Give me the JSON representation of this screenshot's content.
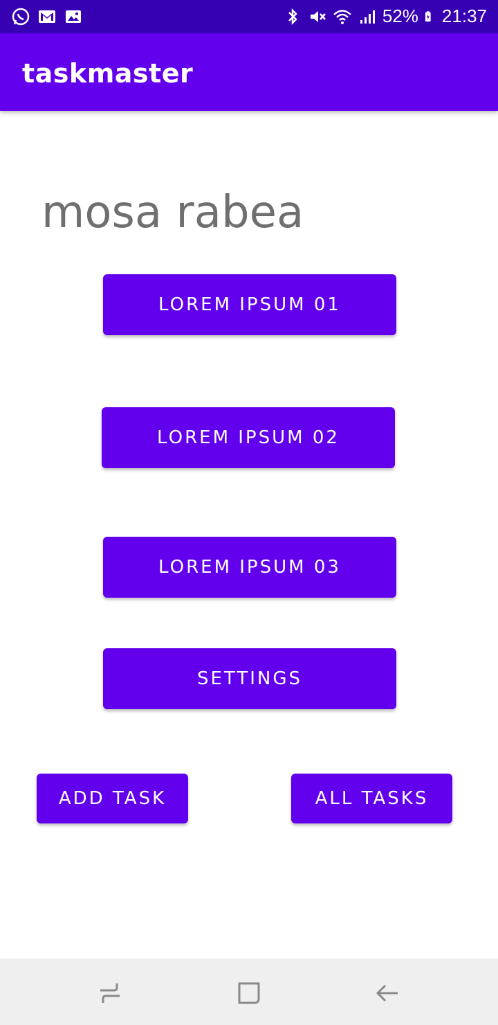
{
  "status_bar": {
    "left_icons": [
      "whatsapp-icon",
      "gmail-icon",
      "gallery-icon"
    ],
    "battery": "52%",
    "time": "21:37",
    "right_icons": [
      "bluetooth-icon",
      "mute-icon",
      "wifi-icon",
      "signal-icon",
      "battery-icon"
    ]
  },
  "app_bar": {
    "title": "taskmaster"
  },
  "main": {
    "username": "mosa rabea",
    "buttons": [
      {
        "label": "LOREM IPSUM 01"
      },
      {
        "label": "LOREM IPSUM 02"
      },
      {
        "label": "LOREM IPSUM 03"
      },
      {
        "label": "SETTINGS"
      }
    ],
    "add_task_label": "ADD TASK",
    "all_tasks_label": "ALL TASKS"
  },
  "nav_bar": {
    "icons": [
      "recents-icon",
      "home-icon",
      "back-icon"
    ]
  },
  "colors": {
    "primary": "#6200ee",
    "status_bar": "#3700b3",
    "username": "#6f6f6f",
    "nav_bar": "#efefef"
  }
}
